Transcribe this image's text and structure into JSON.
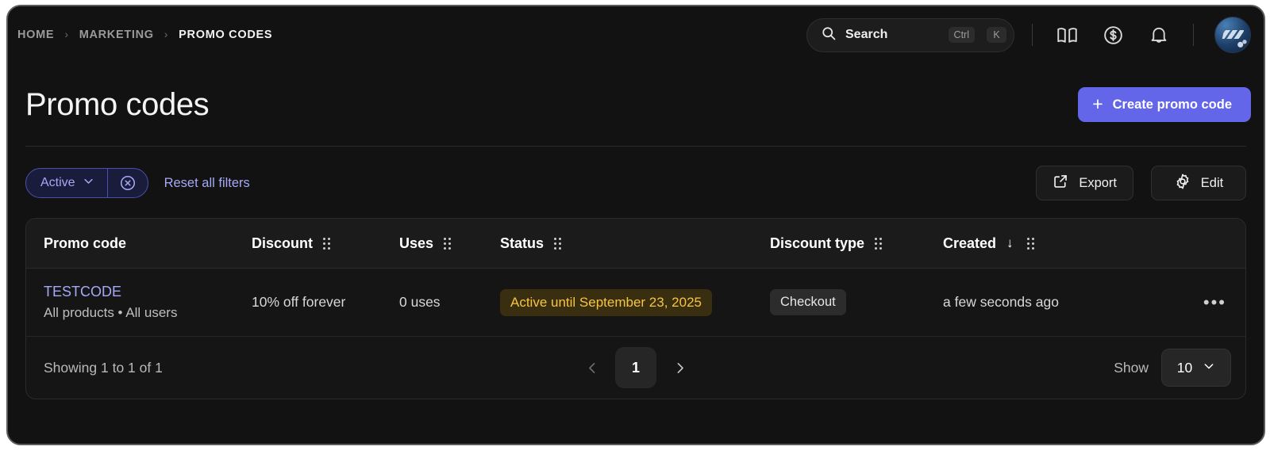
{
  "breadcrumb": {
    "items": [
      {
        "label": "HOME",
        "current": false
      },
      {
        "label": "MARKETING",
        "current": false
      },
      {
        "label": "PROMO CODES",
        "current": true
      }
    ],
    "separator": "›"
  },
  "topbar": {
    "search": {
      "placeholder": "Search",
      "icon": "search-icon",
      "shortcut_modifier": "Ctrl",
      "shortcut_key": "K"
    },
    "icons": [
      {
        "name": "book-icon"
      },
      {
        "name": "dollar-circle-icon"
      },
      {
        "name": "bell-icon"
      }
    ],
    "avatar": {
      "name": "user-avatar"
    }
  },
  "page": {
    "title": "Promo codes",
    "create_button": {
      "label": "Create promo code",
      "icon": "plus-icon",
      "color": "#6366e8"
    }
  },
  "filters": {
    "active_filter": {
      "label": "Active",
      "chevron": "⌄",
      "clear_icon": "circle-x-icon"
    },
    "reset_label": "Reset all filters",
    "export_button": {
      "label": "Export",
      "icon": "external-link-icon"
    },
    "edit_button": {
      "label": "Edit",
      "icon": "gear-icon"
    }
  },
  "table": {
    "columns": [
      {
        "label": "Promo code",
        "handle": false,
        "sorted": false
      },
      {
        "label": "Discount",
        "handle": true,
        "sorted": false
      },
      {
        "label": "Uses",
        "handle": true,
        "sorted": false
      },
      {
        "label": "Status",
        "handle": true,
        "sorted": false
      },
      {
        "label": "Discount type",
        "handle": true,
        "sorted": false
      },
      {
        "label": "Created",
        "handle": true,
        "sorted": true,
        "sort_icon": "↓"
      }
    ],
    "rows": [
      {
        "code": "TESTCODE",
        "code_sub": "All products • All users",
        "discount": "10% off forever",
        "uses": "0 uses",
        "status": "Active until September 23, 2025",
        "status_color": "#f5c542",
        "discount_type": "Checkout",
        "created": "a few seconds ago",
        "menu_icon": "•••"
      }
    ]
  },
  "footer": {
    "showing": "Showing 1 to 1 of 1",
    "prev_icon": "chevron-left-icon",
    "next_icon": "chevron-right-icon",
    "current_page": "1",
    "show_label": "Show",
    "page_size": "10"
  }
}
